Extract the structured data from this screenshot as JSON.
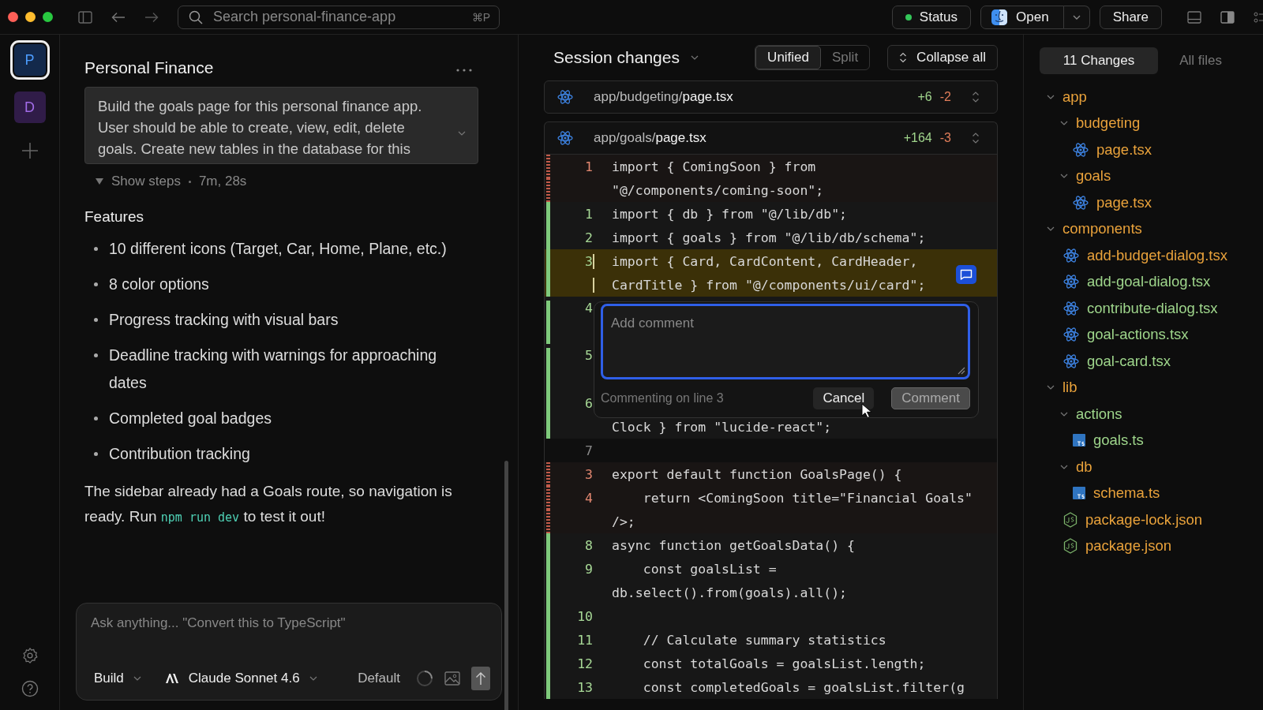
{
  "topbar": {
    "search": {
      "placeholder": "Search personal-finance-app",
      "shortcut": "⌘P"
    },
    "status": {
      "label": "Status",
      "color": "#34c759"
    },
    "open": {
      "label": "Open"
    },
    "share": {
      "label": "Share"
    }
  },
  "rail": {
    "projects": [
      {
        "letter": "P",
        "selected": true
      },
      {
        "letter": "D",
        "selected": false
      }
    ]
  },
  "chat": {
    "title": "Personal Finance",
    "prompt": "Build the goals page for this personal finance app. User should be able to create, view, edit, delete goals. Create new tables in the database for this",
    "steps": {
      "label": "Show steps",
      "expanded": false,
      "duration": "7m, 28s"
    },
    "heading": "Features",
    "bullets": [
      "10 different icons (Target, Car, Home, Plane, etc.)",
      "8 color options",
      "Progress tracking with visual bars",
      "Deadline tracking with warnings for approaching dates",
      "Completed goal badges",
      "Contribution tracking"
    ],
    "summary": [
      {
        "kind": "text",
        "text": "The sidebar already had a Goals route, so navigation is ready. Run "
      },
      {
        "kind": "code",
        "text": "npm run dev"
      },
      {
        "kind": "text",
        "text": " to test it out!"
      }
    ],
    "composer": {
      "placeholder": "Ask anything... \"Convert this to TypeScript\"",
      "mode": "Build",
      "model": "Claude Sonnet 4.6",
      "variant": "Default"
    }
  },
  "diff": {
    "title": "Session changes",
    "views": [
      {
        "label": "Unified",
        "selected": true
      },
      {
        "label": "Split",
        "selected": false
      }
    ],
    "collapse": "Collapse all",
    "files": [
      {
        "dir": "app/budgeting/",
        "name": "page.tsx",
        "added": "+6",
        "removed": "-2"
      },
      {
        "dir": "app/goals/",
        "name": "page.tsx",
        "added": "+164",
        "removed": "-3",
        "rows": [
          {
            "num": "1",
            "text": "import { ComingSoon } from",
            "kind": "removed",
            "selected": false
          },
          {
            "text": "\"@/components/coming-soon\";",
            "kind": "removed",
            "selected": false
          },
          {
            "num": "1",
            "text": "import { db } from \"@/lib/db\";",
            "kind": "added",
            "selected": false
          },
          {
            "num": "2",
            "text": "import { goals } from \"@/lib/db/schema\";",
            "kind": "added",
            "selected": false
          },
          {
            "num": "3",
            "text": "import { Card, CardContent, CardHeader,",
            "kind": "added",
            "selected": true
          },
          {
            "text": "CardTitle } from \"@/components/ui/card\";",
            "kind": "added",
            "selected": true
          },
          {
            "num": "4",
            "kind": "added",
            "wrapped": true,
            "selected": false
          },
          {
            "num": "5",
            "kind": "added",
            "wrapped": true,
            "selected": false
          },
          {
            "num": "6",
            "kind": "added",
            "selected": false
          },
          {
            "text": "Clock } from \"lucide-react\";",
            "kind": "added",
            "selected": false
          },
          {
            "num": "7",
            "kind": "context",
            "selected": false
          },
          {
            "num": "3",
            "text": "export default function GoalsPage() {",
            "kind": "removed",
            "selected": false
          },
          {
            "num": "4",
            "text": "    return <ComingSoon title=\"Financial Goals\"",
            "kind": "removed",
            "selected": false
          },
          {
            "text": "/>;",
            "kind": "removed",
            "selected": false
          },
          {
            "num": "8",
            "text": "async function getGoalsData() {",
            "kind": "added",
            "selected": false
          },
          {
            "num": "9",
            "text": "    const goalsList =",
            "kind": "added",
            "selected": false
          },
          {
            "text": "db.select().from(goals).all();",
            "kind": "added",
            "selected": false
          },
          {
            "num": "10",
            "kind": "added",
            "selected": false
          },
          {
            "num": "11",
            "text": "    // Calculate summary statistics",
            "kind": "added",
            "selected": false
          },
          {
            "num": "12",
            "text": "    const totalGoals = goalsList.length;",
            "kind": "added",
            "selected": false
          },
          {
            "num": "13",
            "text": "    const completedGoals = goalsList.filter(g",
            "kind": "added",
            "selected": false
          }
        ]
      }
    ],
    "comment": {
      "placeholder": "Add comment",
      "note": "Commenting on line 3",
      "cancel": "Cancel",
      "submit": "Comment",
      "submit_disabled": true
    }
  },
  "tree": {
    "tabs": [
      {
        "label": "11 Changes",
        "selected": true
      },
      {
        "label": "All files",
        "selected": false
      }
    ],
    "items": [
      {
        "name": "app",
        "kind": "folder",
        "color": "#e9a23b",
        "expanded": true,
        "children": [
          {
            "name": "budgeting",
            "kind": "folder",
            "color": "#e9a23b",
            "expanded": true,
            "children": [
              {
                "name": "page.tsx",
                "kind": "react",
                "color": "#e9a23b"
              }
            ]
          },
          {
            "name": "goals",
            "kind": "folder",
            "color": "#e9a23b",
            "expanded": true,
            "children": [
              {
                "name": "page.tsx",
                "kind": "react",
                "color": "#e9a23b"
              }
            ]
          }
        ]
      },
      {
        "name": "components",
        "kind": "folder",
        "color": "#e9a23b",
        "expanded": true,
        "children": [
          {
            "name": "add-budget-dialog.tsx",
            "kind": "react",
            "color": "#e9a23b"
          },
          {
            "name": "add-goal-dialog.tsx",
            "kind": "react",
            "color": "#9ed58b"
          },
          {
            "name": "contribute-dialog.tsx",
            "kind": "react",
            "color": "#9ed58b"
          },
          {
            "name": "goal-actions.tsx",
            "kind": "react",
            "color": "#9ed58b"
          },
          {
            "name": "goal-card.tsx",
            "kind": "react",
            "color": "#9ed58b"
          }
        ]
      },
      {
        "name": "lib",
        "kind": "folder",
        "color": "#e9a23b",
        "expanded": true,
        "children": [
          {
            "name": "actions",
            "kind": "folder",
            "color": "#9ed58b",
            "expanded": true,
            "children": [
              {
                "name": "goals.ts",
                "kind": "ts",
                "color": "#9ed58b"
              }
            ]
          },
          {
            "name": "db",
            "kind": "folder",
            "color": "#e9a23b",
            "expanded": true,
            "children": [
              {
                "name": "schema.ts",
                "kind": "ts",
                "color": "#e9a23b"
              }
            ]
          }
        ]
      },
      {
        "name": "package-lock.json",
        "kind": "json",
        "color": "#e9a23b"
      },
      {
        "name": "package.json",
        "kind": "json",
        "color": "#e9a23b"
      }
    ]
  }
}
